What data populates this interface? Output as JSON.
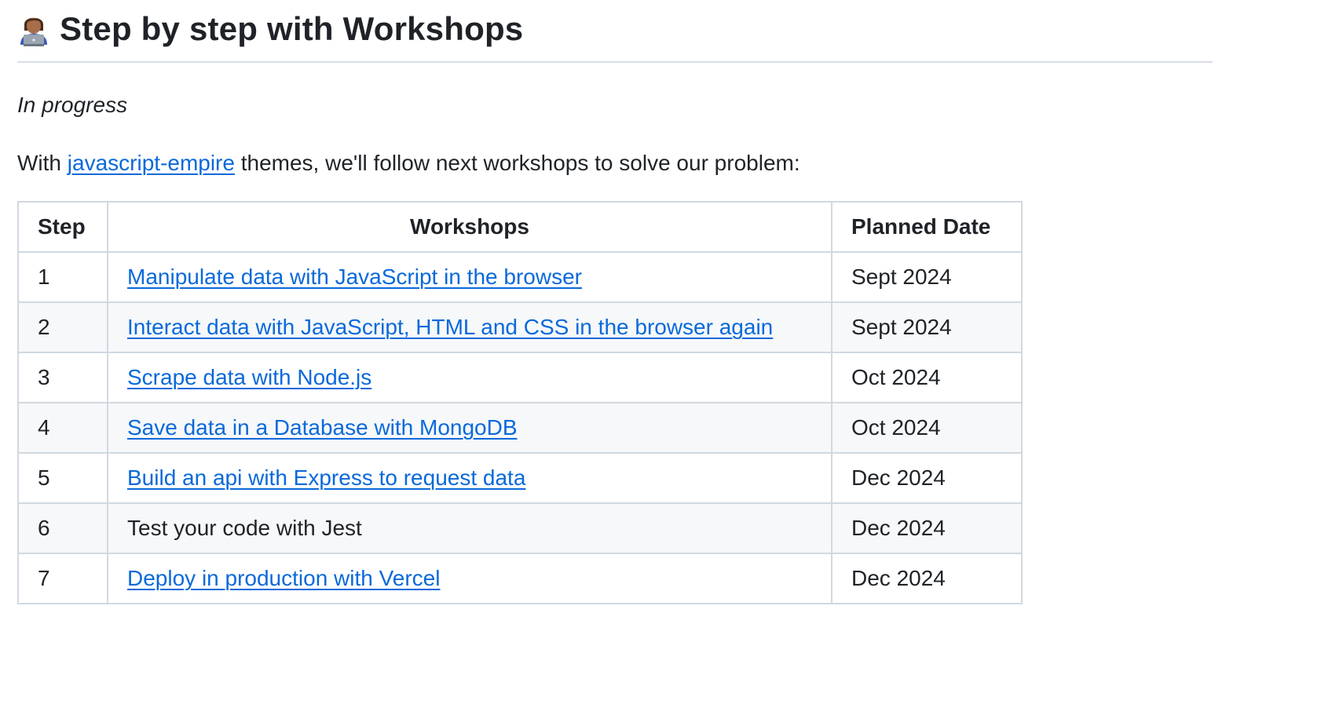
{
  "heading": {
    "icon": "technologist-emoji-icon",
    "title": "Step by step with Workshops"
  },
  "status": "In progress",
  "intro": {
    "prefix": "With ",
    "link_text": "javascript-empire",
    "suffix": " themes, we'll follow next workshops to solve our problem:"
  },
  "colors": {
    "link": "#0969da",
    "text": "#1f2328",
    "border": "#d1d9e0",
    "row_stripe": "#f6f8fa"
  },
  "table": {
    "headers": [
      "Step",
      "Workshops",
      "Planned Date"
    ],
    "rows": [
      {
        "step": "1",
        "workshop": "Manipulate data with JavaScript in the browser",
        "is_link": true,
        "date": "Sept 2024"
      },
      {
        "step": "2",
        "workshop": "Interact data with JavaScript, HTML and CSS in the browser again",
        "is_link": true,
        "date": "Sept 2024"
      },
      {
        "step": "3",
        "workshop": "Scrape data with Node.js",
        "is_link": true,
        "date": "Oct 2024"
      },
      {
        "step": "4",
        "workshop": "Save data in a Database with MongoDB",
        "is_link": true,
        "date": "Oct 2024"
      },
      {
        "step": "5",
        "workshop": "Build an api with Express to request data",
        "is_link": true,
        "date": "Dec 2024"
      },
      {
        "step": "6",
        "workshop": "Test your code with Jest",
        "is_link": false,
        "date": "Dec 2024"
      },
      {
        "step": "7",
        "workshop": "Deploy in production with Vercel",
        "is_link": true,
        "date": "Dec 2024"
      }
    ]
  }
}
